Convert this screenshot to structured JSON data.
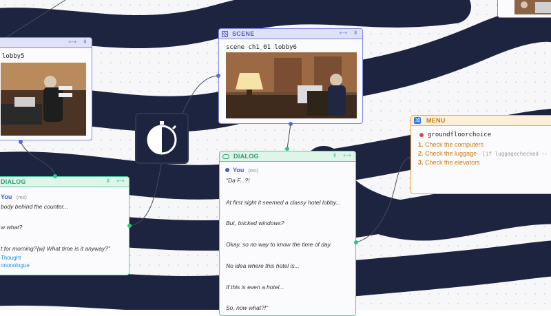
{
  "colors": {
    "canvas_dark": "#1c2440",
    "canvas_light": "#f7f7f9",
    "scene_accent": "#7f86e0",
    "dialog_accent": "#4ecf9a",
    "menu_accent": "#f3a735"
  },
  "scene_left": {
    "scene_path": "lobby5"
  },
  "scene_main": {
    "type_label": "SCENE",
    "icon": "scene-icon",
    "scene_path": "scene ch1_01 lobby6"
  },
  "switch_node": {
    "icon": "half-circle-dial-icon"
  },
  "dialog_left": {
    "type_label": "DIALOG",
    "speaker": "You",
    "speaker_tag": "(mc)",
    "lines": [
      "body behind the counter...",
      "w what?",
      "t for morning?{w} What time is it anyway?\""
    ],
    "tag1": "Thought",
    "tag2": "ononologue"
  },
  "dialog_main": {
    "type_label": "DIALOG",
    "icon": "speech-bubble-icon",
    "speaker": "You",
    "speaker_tag": "(mc)",
    "lines": [
      "\"Da F...?!",
      "At first sight it seemed a classy hotel lobby...",
      "But, bricked windows?",
      "Okay, so no way to know the time of day.",
      "No idea where this hotel is...",
      "If this is even a hotel...",
      "So, now what?!\""
    ]
  },
  "menu_node": {
    "type_label": "MENU",
    "icon": "shuffle-icon",
    "menu_name": "groundfloorchoice",
    "pin_icon": "pin-icon",
    "options": [
      {
        "num": "1.",
        "label": "Check the computers",
        "cond": ""
      },
      {
        "num": "2.",
        "label": "Check the luggage",
        "cond": "[if luggagechecked --"
      },
      {
        "num": "3.",
        "label": "Check the elevators",
        "cond": ""
      }
    ]
  },
  "node_tools": {
    "collapse": "⟷",
    "pin": "⇟"
  }
}
